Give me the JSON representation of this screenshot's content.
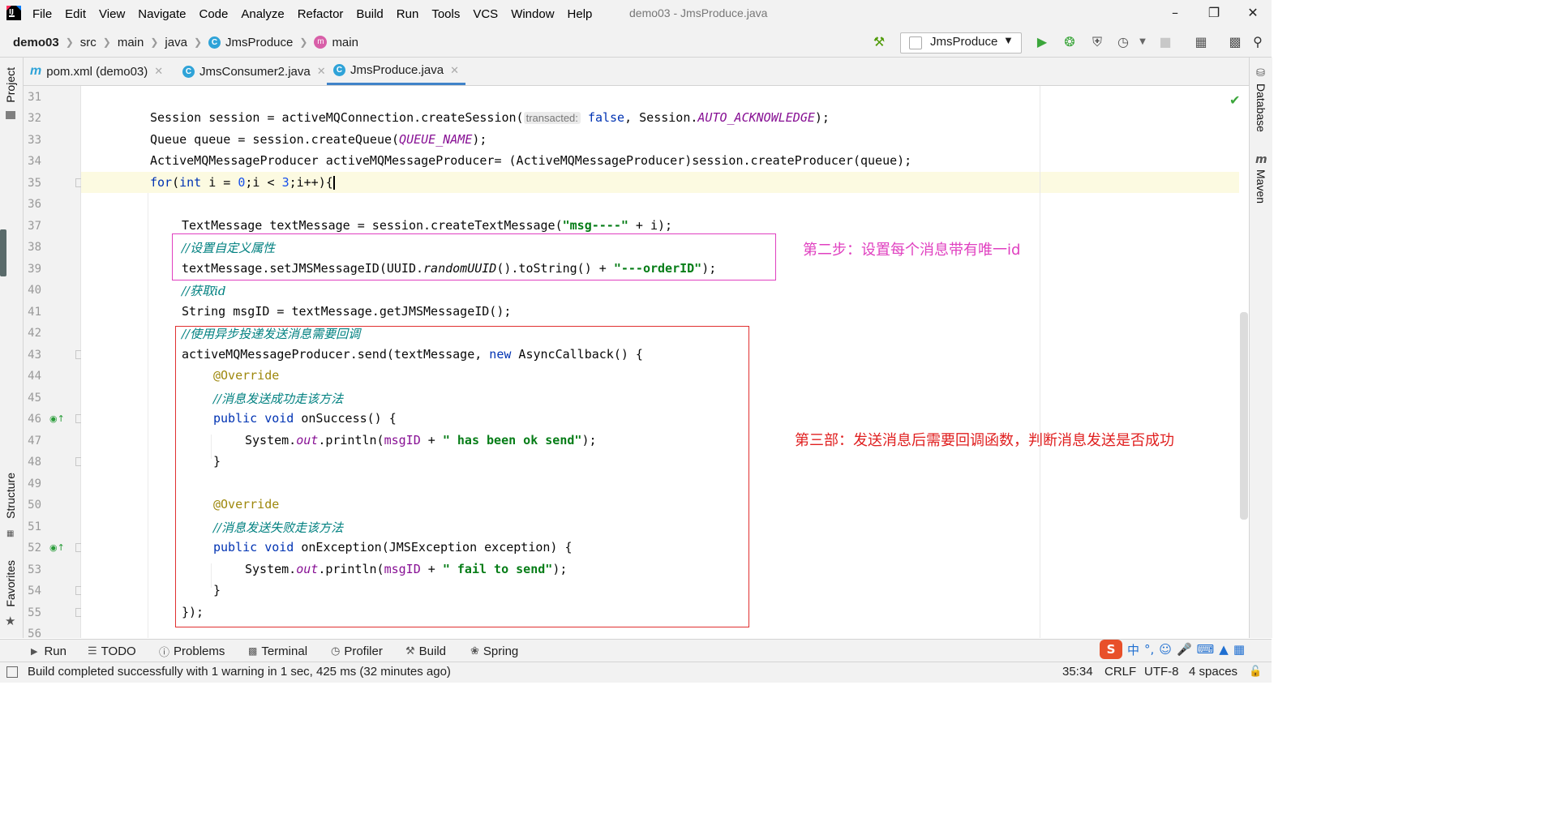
{
  "window": {
    "title": "demo03 - JmsProduce.java"
  },
  "menu": [
    "File",
    "Edit",
    "View",
    "Navigate",
    "Code",
    "Analyze",
    "Refactor",
    "Build",
    "Run",
    "Tools",
    "VCS",
    "Window",
    "Help"
  ],
  "breadcrumb": {
    "project": "demo03",
    "src": "src",
    "main": "main",
    "java": "java",
    "class": "JmsProduce",
    "method": "main"
  },
  "run_config": {
    "label": "JmsProduce"
  },
  "left_tools": {
    "project": "Project",
    "structure": "Structure",
    "favorites": "Favorites"
  },
  "right_tools": {
    "database": "Database",
    "maven": "Maven"
  },
  "tabs": [
    {
      "label": "pom.xml (demo03)",
      "icon": "maven-icon"
    },
    {
      "label": "JmsConsumer2.java",
      "icon": "java-class-icon"
    },
    {
      "label": "JmsProduce.java",
      "icon": "java-class-icon",
      "active": true
    }
  ],
  "line_numbers": [
    "31",
    "32",
    "33",
    "34",
    "35",
    "36",
    "37",
    "38",
    "39",
    "40",
    "41",
    "42",
    "43",
    "44",
    "45",
    "46",
    "47",
    "48",
    "49",
    "50",
    "51",
    "52",
    "53",
    "54",
    "55",
    "56"
  ],
  "code": {
    "l32a": "Session session = activeMQConnection.createSession(",
    "l32hint": "transacted:",
    "l32false": "false",
    "l32b": ", Session.",
    "l32const": "AUTO_ACKNOWLEDGE",
    "l32c": ");",
    "l33a": "Queue queue = session.createQueue(",
    "l33const": "QUEUE_NAME",
    "l33b": ");",
    "l34": "ActiveMQMessageProducer activeMQMessageProducer= (ActiveMQMessageProducer)session.createProducer(queue);",
    "l35for": "for",
    "l35a": "(",
    "l35int": "int",
    "l35b": " i = ",
    "l35zero": "0",
    "l35c": ";i < ",
    "l35three": "3",
    "l35d": ";i++){",
    "l37a": "TextMessage textMessage = session.createTextMessage(",
    "l37str": "\"msg----\"",
    "l37b": " + i);",
    "l38": "//设置自定义属性",
    "l39a": "textMessage.setJMSMessageID(UUID.",
    "l39m": "randomUUID",
    "l39b": "().toString() + ",
    "l39str": "\"---orderID\"",
    "l39c": ");",
    "l40": "//获取id",
    "l41": "String msgID = textMessage.getJMSMessageID();",
    "l42": "//使用异步投递发送消息需要回调",
    "l43a": "activeMQMessageProducer.send(textMessage, ",
    "l43new": "new",
    "l43b": " AsyncCallback() {",
    "l44": "@Override",
    "l45": "//消息发送成功走该方法",
    "l46kw": "public void",
    "l46b": " onSuccess() {",
    "l47a": "System.",
    "l47out": "out",
    "l47b": ".println(",
    "l47fld": "msgID",
    "l47c": " + ",
    "l47str": "\" has been ok send\"",
    "l47d": ");",
    "l48": "}",
    "l50": "@Override",
    "l51": "//消息发送失败走该方法",
    "l52kw": "public void",
    "l52b": " onException(JMSException exception) {",
    "l53a": "System.",
    "l53out": "out",
    "l53b": ".println(",
    "l53fld": "msgID",
    "l53c": " + ",
    "l53str": "\" fail to send\"",
    "l53d": ");",
    "l54": "}",
    "l55": "});"
  },
  "annotations": {
    "step2": "第二步：设置每个消息带有唯一id",
    "step3": "第三部：发送消息后需要回调函数，判断消息发送是否成功"
  },
  "tool_windows": [
    "Run",
    "TODO",
    "Problems",
    "Terminal",
    "Profiler",
    "Build",
    "Spring"
  ],
  "status": {
    "message": "Build completed successfully with 1 warning in 1 sec, 425 ms (32 minutes ago)",
    "position": "35:34",
    "line_sep": "CRLF",
    "encoding": "UTF-8",
    "indent": "4 spaces"
  },
  "ime": {
    "lang": "中"
  },
  "colors": {
    "pink_note": "#e040c0",
    "red_note": "#e02020",
    "keyword": "#0033b3",
    "string": "#067d17"
  }
}
